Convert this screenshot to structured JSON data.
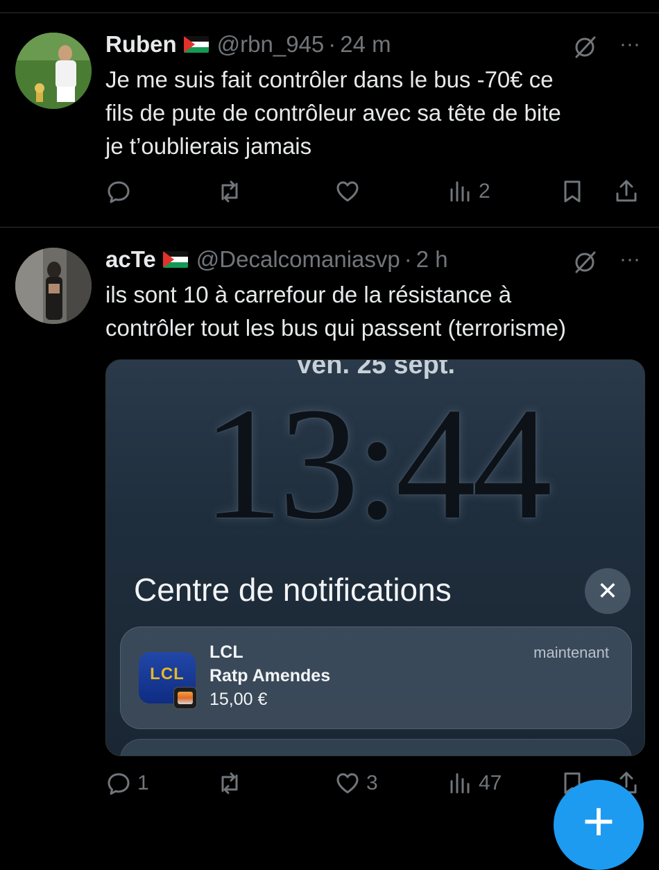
{
  "tweets": [
    {
      "name": "Ruben",
      "handle": "@rbn_945",
      "separator": "·",
      "time": "24 m",
      "text": "Je me suis fait contrôler dans le bus -70€ ce\nfils de pute de contrôleur avec sa tête de bite\nje t’oublierais jamais",
      "replies": "",
      "retweets": "",
      "likes": "",
      "views": "2"
    },
    {
      "name": "acTe",
      "handle": "@Decalcomaniasvp",
      "separator": "·",
      "time": "2 h",
      "text": "ils sont 10 à carrefour de la résistance à\ncontrôler tout les bus qui passent (terrorisme)",
      "replies": "1",
      "retweets": "",
      "likes": "3",
      "views": "47",
      "media": {
        "date": "Ven. 25 sept.",
        "clock": "13:44",
        "notification_center_title": "Centre de notifications",
        "close_glyph": "✕",
        "notification": {
          "app_logo": "LCL",
          "app": "LCL",
          "time": "maintenant",
          "title": "Ratp Amendes",
          "body": "15,00 €"
        }
      }
    }
  ],
  "more_glyph": "···",
  "compose_glyph": "+",
  "colors": {
    "background": "#000000",
    "text": "#e7e9ea",
    "muted": "#71767b",
    "accent": "#1d9bf0"
  }
}
